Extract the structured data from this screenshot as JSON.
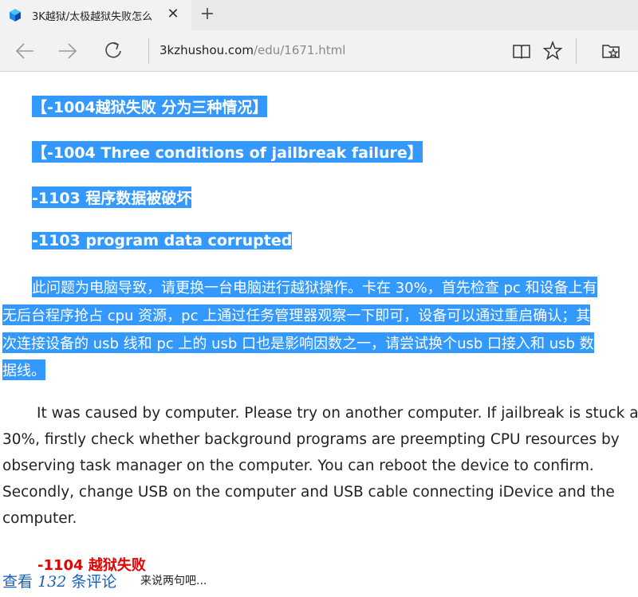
{
  "browser": {
    "tab_title": "3K越狱/太极越狱失败怎么",
    "tab_close": "✕",
    "new_tab": "+",
    "address_domain": "3kzhushou.com",
    "address_path": "/edu/1671.html"
  },
  "article": {
    "heading1_cn": "【-1004越狱失败 分为三种情况】",
    "heading1_en": "【-1004 Three conditions of jailbreak failure】",
    "heading2_cn": "-1103 程序数据被破坏",
    "heading2_en": "-1103 program data corrupted",
    "cn_paragraph_lines": [
      "此问题为电脑导致，请更换一台电脑进行越狱操作。卡在 30%，首先检查 pc 和设备上有",
      "无后台程序抢占 cpu 资源，pc 上通过任务管理器观察一下即可，设备可以通过重启确认；其",
      "次连接设备的 usb 线和 pc 上的 usb 口也是影响因数之一，请尝试换个usb 口接入和 usb 数",
      "据线。"
    ],
    "en_paragraph_lines": [
      "It was caused by computer. Please try on another computer. If jailbreak is stuck at",
      "30%, firstly check whether background programs are preempting CPU resources by",
      "observing task manager on the computer. You can reboot the device to confirm.",
      "Secondly, change USB on the computer and USB cable connecting iDevice and the",
      "computer."
    ],
    "heading3_cn": "-1104 越狱失败"
  },
  "comments": {
    "prefix": "查看",
    "count": "132",
    "suffix": "条评论",
    "hint": "来说两句吧..."
  },
  "colors": {
    "selection": "#3399ff",
    "red_heading": "#e60000",
    "link": "#1a5fb4"
  }
}
